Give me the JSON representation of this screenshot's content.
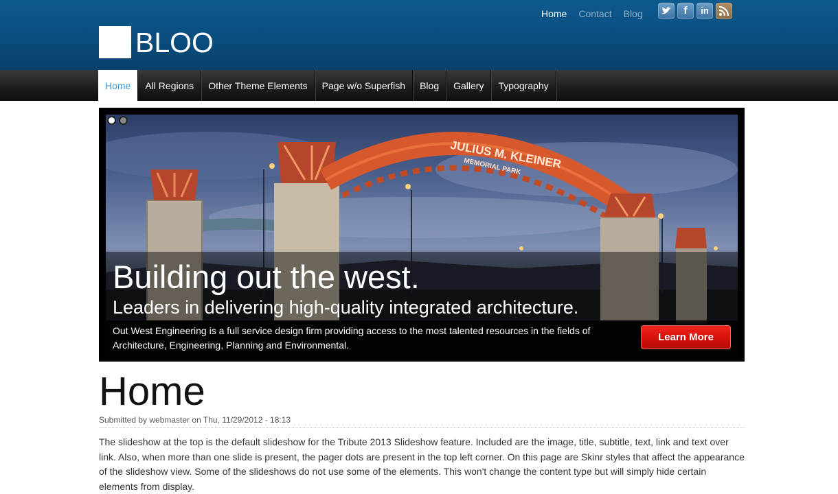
{
  "header": {
    "logo_text": "BLOO",
    "top_links": [
      {
        "label": "Home",
        "active": true
      },
      {
        "label": "Contact",
        "active": false
      },
      {
        "label": "Blog",
        "active": false
      }
    ],
    "social_icons": [
      "twitter-icon",
      "facebook-icon",
      "linkedin-icon",
      "rss-icon"
    ],
    "social_labels": {
      "facebook": "f",
      "linkedin": "in"
    }
  },
  "nav": {
    "items": [
      {
        "label": "Home",
        "active": true
      },
      {
        "label": "All Regions",
        "active": false
      },
      {
        "label": "Other Theme Elements",
        "active": false
      },
      {
        "label": "Page w/o Superfish",
        "active": false
      },
      {
        "label": "Blog",
        "active": false
      },
      {
        "label": "Gallery",
        "active": false
      },
      {
        "label": "Typography",
        "active": false
      }
    ]
  },
  "slideshow": {
    "pager_dots": 2,
    "active_dot": 1,
    "arch_sign_line1": "JULIUS M. KLEINER",
    "arch_sign_line2": "MEMORIAL PARK",
    "title": "Building out the west.",
    "subtitle": "Leaders in delivering high-quality integrated architecture.",
    "text": "Out West Engineering is a full service design firm providing access to the most talented resources in the fields of Architecture, Engineering, Planning and Environmental.",
    "link_label": "Learn More"
  },
  "content": {
    "title": "Home",
    "submitted": "Submitted by webmaster on Thu, 11/29/2012 - 18:13",
    "body": "The slideshow at the top is the default slideshow for the Tribute 2013 Slideshow feature. Included are the image, title, subtitle, text, link and text over link. Also, when more than one slide is present, the pager dots are present in the top left corner. On this page are Skinr styles that affect the appearance of the slideshow view. Some of the slideshows do not use some of the elements. This won't change the content type but will simply hide certain elements from display."
  },
  "colors": {
    "header_blue": "#0a4d7e",
    "nav_active_text": "#3a9ad9",
    "button_red": "#d8120d"
  }
}
